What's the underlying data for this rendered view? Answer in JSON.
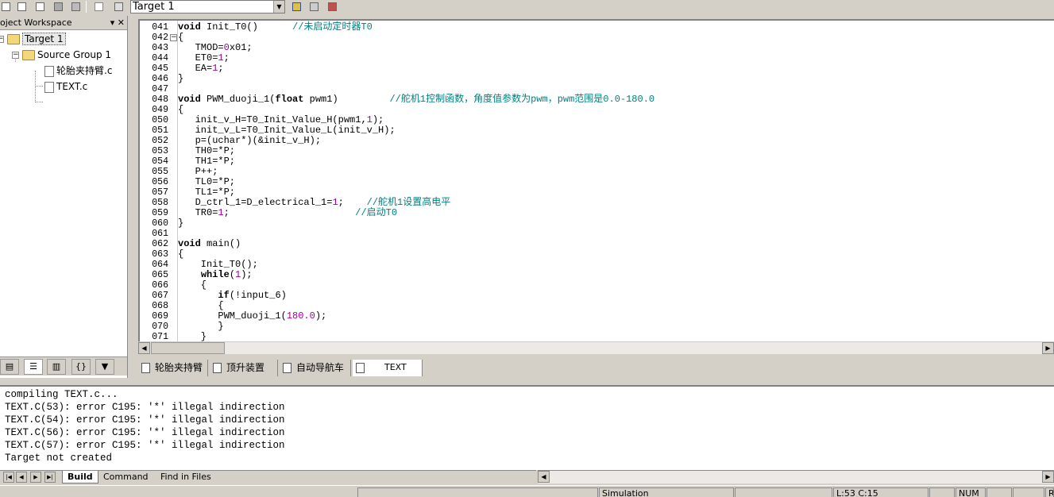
{
  "toolbar": {
    "target_select_value": "Target 1",
    "icons": [
      "new-project-icon",
      "open-icon",
      "save-icon",
      "stack-icon",
      "download-icon",
      "build-icon",
      "rebuild-icon",
      "translate-icon",
      "options-icon",
      "components-icon",
      "batch-icon"
    ]
  },
  "workspace": {
    "title": "oject Workspace",
    "controls": "▾ ✕",
    "tree": {
      "target": "Target 1",
      "group": "Source Group 1",
      "files": [
        "轮胎夹持臂.c",
        "TEXT.c"
      ]
    },
    "tabs": [
      "files-tab",
      "regs-tab",
      "books-tab",
      "functions-tab",
      "templates-tab"
    ]
  },
  "editor": {
    "lines": [
      {
        "num": "041",
        "text": "void Init_T0()      //未启动定时器T0"
      },
      {
        "num": "042",
        "text": "{"
      },
      {
        "num": "043",
        "text": "   TMOD=0x01;"
      },
      {
        "num": "044",
        "text": "   ET0=1;"
      },
      {
        "num": "045",
        "text": "   EA=1;"
      },
      {
        "num": "046",
        "text": "}"
      },
      {
        "num": "047",
        "text": ""
      },
      {
        "num": "048",
        "text": "void PWM_duoji_1(float pwm1)         //舵机1控制函数，角度值参数为pwm，pwm范围是0.0-180.0"
      },
      {
        "num": "049",
        "text": "{"
      },
      {
        "num": "050",
        "text": "   init_v_H=T0_Init_Value_H(pwm1,1);"
      },
      {
        "num": "051",
        "text": "   init_v_L=T0_Init_Value_L(init_v_H);"
      },
      {
        "num": "052",
        "text": "   p=(uchar*)(&init_v_H);"
      },
      {
        "num": "053",
        "text": "   TH0=*P;"
      },
      {
        "num": "054",
        "text": "   TH1=*P;"
      },
      {
        "num": "055",
        "text": "   P++;"
      },
      {
        "num": "056",
        "text": "   TL0=*P;"
      },
      {
        "num": "057",
        "text": "   TL1=*P;"
      },
      {
        "num": "058",
        "text": "   D_ctrl_1=D_electrical_1=1;    //舵机1设置高电平"
      },
      {
        "num": "059",
        "text": "   TR0=1;                      //启动T0"
      },
      {
        "num": "060",
        "text": "}"
      },
      {
        "num": "061",
        "text": ""
      },
      {
        "num": "062",
        "text": "void main()"
      },
      {
        "num": "063",
        "text": "{"
      },
      {
        "num": "064",
        "text": "    Init_T0();"
      },
      {
        "num": "065",
        "text": "    while(1);"
      },
      {
        "num": "066",
        "text": "    {"
      },
      {
        "num": "067",
        "text": "       if(!input_6)"
      },
      {
        "num": "068",
        "text": "       {"
      },
      {
        "num": "069",
        "text": "       PWM_duoji_1(180.0);"
      },
      {
        "num": "070",
        "text": "       }"
      },
      {
        "num": "071",
        "text": "    }"
      }
    ]
  },
  "file_tabs": [
    "轮胎夹持臂",
    "顶升装置",
    "自动导航车",
    "TEXT"
  ],
  "output": {
    "lines": [
      "compiling TEXT.c...",
      "TEXT.C(53): error C195: '*' illegal indirection",
      "TEXT.C(54): error C195: '*' illegal indirection",
      "TEXT.C(56): error C195: '*' illegal indirection",
      "TEXT.C(57): error C195: '*' illegal indirection",
      "Target not created"
    ],
    "tabs": {
      "build": "Build",
      "command": "Command",
      "find": "Find in Files"
    }
  },
  "status": {
    "mode": "Simulation",
    "position": "L:53 C:15",
    "num": "NUM",
    "r": "R"
  },
  "colors": {
    "comment": "#007f7f",
    "number": "#a000a0",
    "panel": "#d4d0c8"
  }
}
